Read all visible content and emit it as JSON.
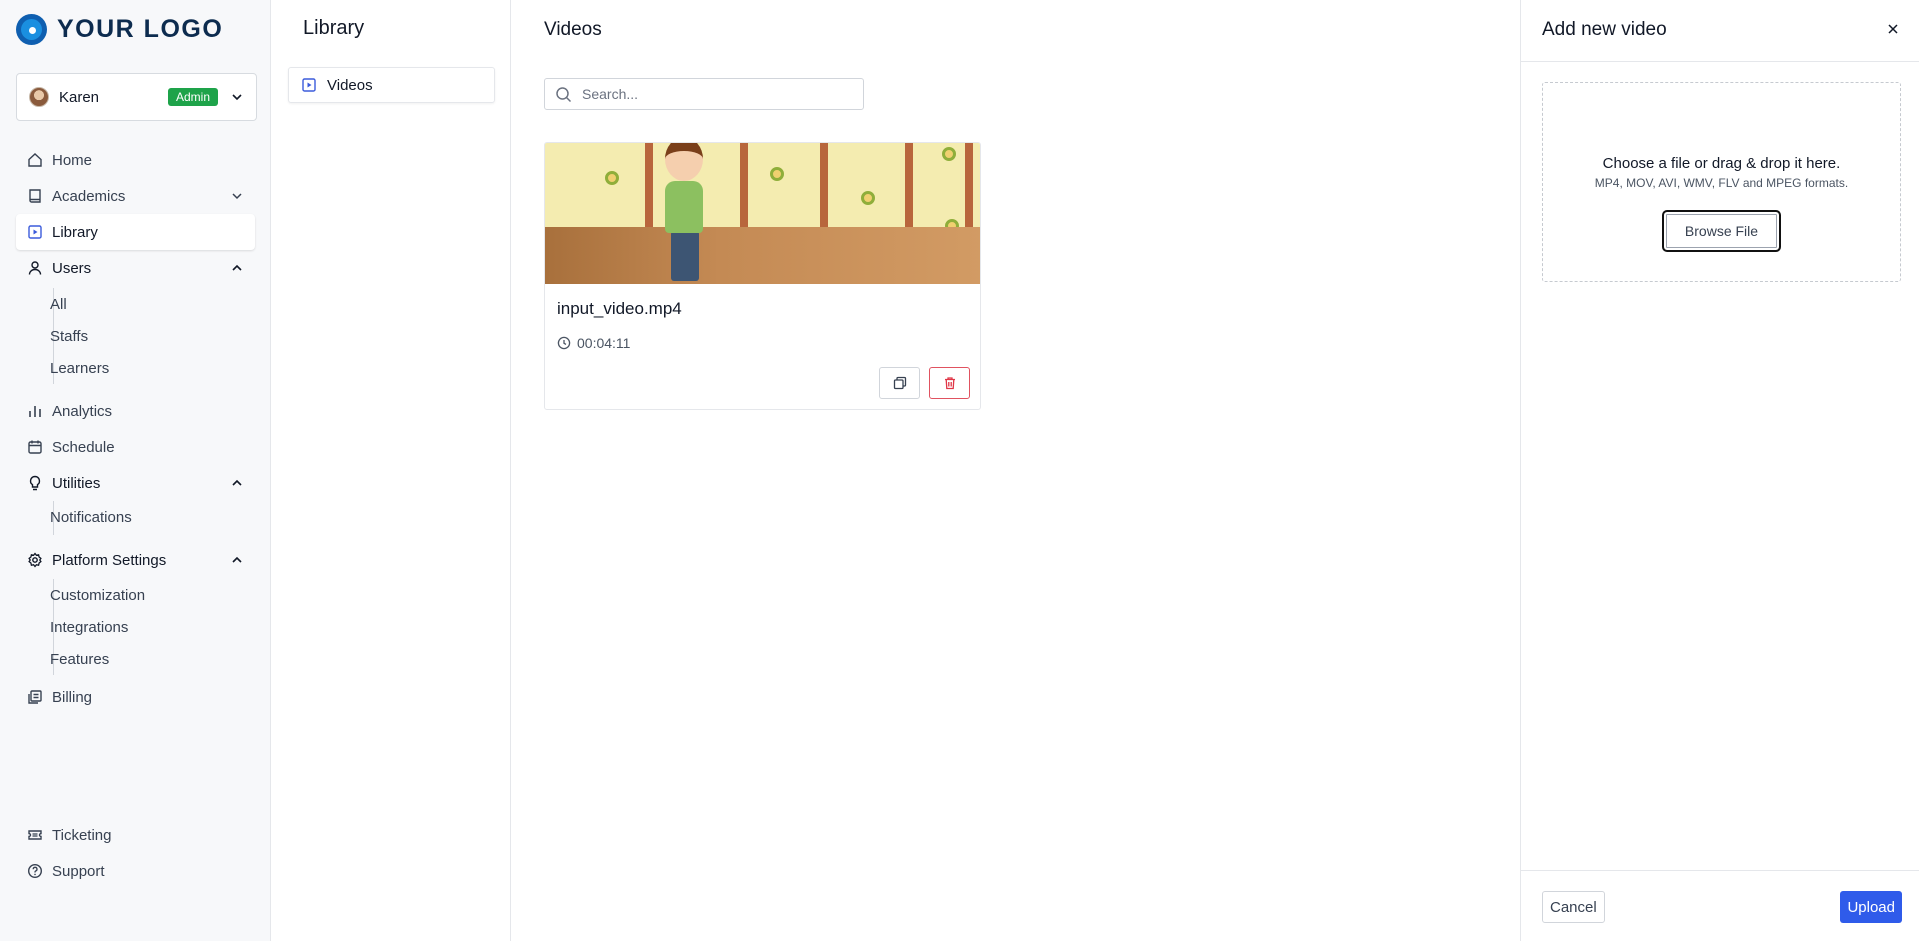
{
  "brand": {
    "logo_text": "YOUR LOGO"
  },
  "user": {
    "name": "Karen",
    "role_badge": "Admin"
  },
  "sidebar": {
    "home": "Home",
    "academics": "Academics",
    "library": "Library",
    "users": "Users",
    "users_sub": [
      "All",
      "Staffs",
      "Learners"
    ],
    "analytics": "Analytics",
    "schedule": "Schedule",
    "utilities": "Utilities",
    "utilities_sub": [
      "Notifications"
    ],
    "platform_settings": "Platform Settings",
    "platform_sub": [
      "Customization",
      "Integrations",
      "Features"
    ],
    "billing": "Billing",
    "ticketing": "Ticketing",
    "support": "Support"
  },
  "library_panel": {
    "title": "Library",
    "items": [
      "Videos"
    ]
  },
  "main": {
    "title": "Videos",
    "search_placeholder": "Search...",
    "videos": [
      {
        "filename": "input_video.mp4",
        "duration": "00:04:11"
      }
    ]
  },
  "drawer": {
    "title": "Add new video",
    "drop_main": "Choose a file or drag & drop it here.",
    "drop_sub": "MP4, MOV, AVI, WMV, FLV and MPEG formats.",
    "browse": "Browse File",
    "cancel": "Cancel",
    "upload": "Upload"
  },
  "colors": {
    "accent": "#2f5bea",
    "badge": "#1ea34a",
    "danger": "#e03546"
  }
}
